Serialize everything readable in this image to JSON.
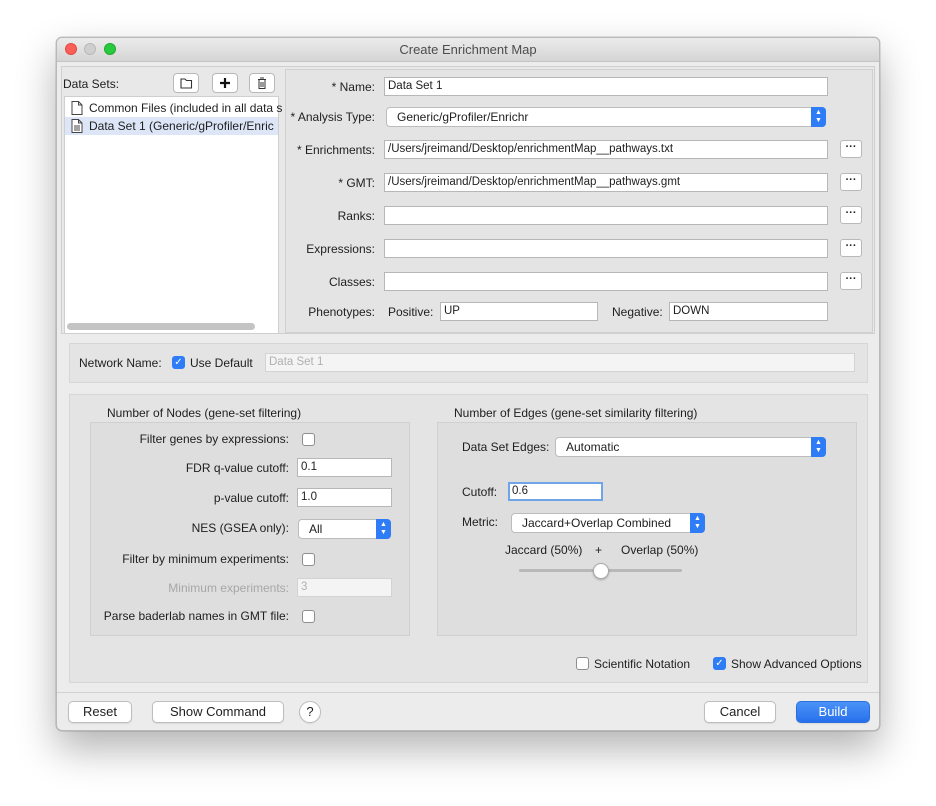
{
  "window": {
    "title": "Create Enrichment Map"
  },
  "datasets": {
    "label": "Data Sets:",
    "items": [
      {
        "label": "Common Files (included in all data s",
        "selected": false
      },
      {
        "label": "Data Set 1  (Generic/gProfiler/Enric",
        "selected": true
      }
    ]
  },
  "form": {
    "name_label": "* Name:",
    "name_value": "Data Set 1",
    "analysis_label": "* Analysis Type:",
    "analysis_value": "Generic/gProfiler/Enrichr",
    "enrich_label": "* Enrichments:",
    "enrich_value": "/Users/jreimand/Desktop/enrichmentMap__pathways.txt",
    "gmt_label": "* GMT:",
    "gmt_value": "/Users/jreimand/Desktop/enrichmentMap__pathways.gmt",
    "ranks_label": "Ranks:",
    "ranks_value": "",
    "expr_label": "Expressions:",
    "expr_value": "",
    "classes_label": "Classes:",
    "classes_value": "",
    "pheno_label": "Phenotypes:",
    "positive_label": "Positive:",
    "positive_value": "UP",
    "negative_label": "Negative:",
    "negative_value": "DOWN",
    "dots": "···"
  },
  "network": {
    "label": "Network Name:",
    "use_default_label": "Use Default",
    "use_default_checked": true,
    "name_placeholder": "Data Set 1"
  },
  "nodes": {
    "heading": "Number of Nodes (gene-set filtering)",
    "filter_genes_label": "Filter genes by expressions:",
    "fdr_label": "FDR q-value cutoff:",
    "fdr_value": "0.1",
    "p_label": "p-value cutoff:",
    "p_value": "1.0",
    "nes_label": "NES (GSEA only):",
    "nes_value": "All",
    "min_exp_filter_label": "Filter by minimum experiments:",
    "min_exp_label": "Minimum experiments:",
    "min_exp_value": "3",
    "baderlab_label": "Parse baderlab names in GMT file:"
  },
  "edges": {
    "heading": "Number of Edges (gene-set similarity filtering)",
    "dataset_edges_label": "Data Set Edges:",
    "dataset_edges_value": "Automatic",
    "cutoff_label": "Cutoff:",
    "cutoff_value": "0.6",
    "metric_label": "Metric:",
    "metric_value": "Jaccard+Overlap Combined",
    "jaccard_label": "Jaccard (50%)",
    "plus": "+",
    "overlap_label": "Overlap (50%)",
    "slider_fraction": 0.5
  },
  "options": {
    "scientific_label": "Scientific Notation",
    "scientific_checked": false,
    "advanced_label": "Show Advanced Options",
    "advanced_checked": true
  },
  "footer": {
    "reset": "Reset",
    "show_command": "Show Command",
    "help": "?",
    "cancel": "Cancel",
    "build": "Build"
  },
  "colors": {
    "accent": "#2e7cf6",
    "selection": "#dce6f7"
  }
}
